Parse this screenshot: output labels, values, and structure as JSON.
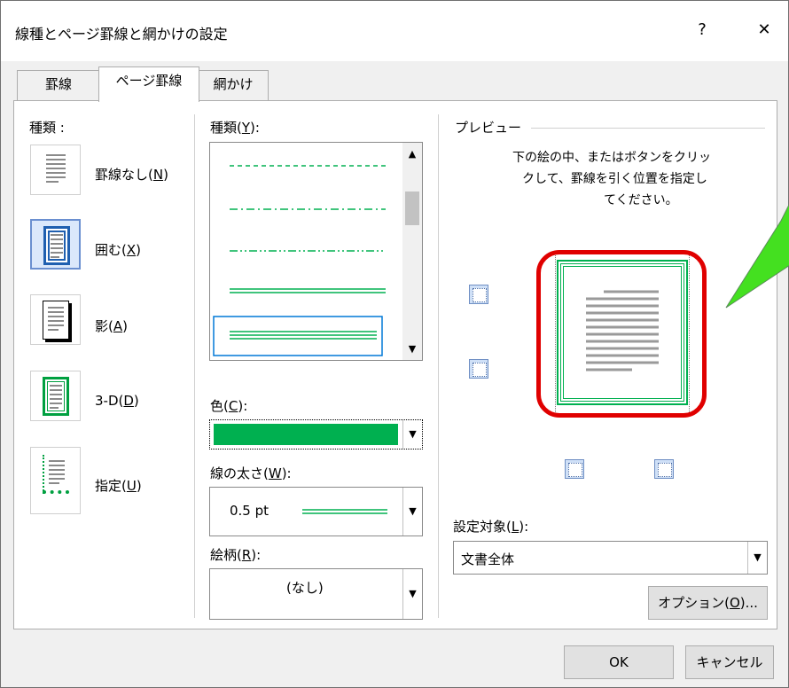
{
  "window": {
    "title": "線種とページ罫線と網かけの設定",
    "help_label": "?",
    "close_label": "✕"
  },
  "tabs": [
    {
      "label": "罫線",
      "active": false
    },
    {
      "label": "ページ罫線",
      "active": true
    },
    {
      "label": "網かけ",
      "active": false
    }
  ],
  "setting": {
    "heading": "種類 :",
    "items": [
      {
        "label": "罫線なし(",
        "key": "N",
        "close": ")"
      },
      {
        "label": "囲む(",
        "key": "X",
        "close": ")"
      },
      {
        "label": "影(",
        "key": "A",
        "close": ")"
      },
      {
        "label": "3-D(",
        "key": "D",
        "close": ")"
      },
      {
        "label": "指定(",
        "key": "U",
        "close": ")"
      }
    ]
  },
  "style": {
    "label_prefix": "種類(",
    "key": "Y",
    "label_suffix": "):"
  },
  "color": {
    "label_prefix": "色(",
    "key": "C",
    "label_suffix": "):",
    "value_hex": "#00b050"
  },
  "width": {
    "label_prefix": "線の太さ(",
    "key": "W",
    "label_suffix": "):",
    "value": "0.5 pt"
  },
  "art": {
    "label_prefix": "絵柄(",
    "key": "R",
    "label_suffix": "):",
    "value": "(なし)"
  },
  "preview": {
    "heading": "プレビュー",
    "instruction_1": "下の絵の中、またはボタンをクリッ",
    "instruction_2": "クして、罫線を引く位置を指定し",
    "instruction_3": "てください。"
  },
  "apply_to": {
    "label_prefix": "設定対象(",
    "key": "L",
    "label_suffix": "):",
    "value": "文書全体"
  },
  "options": {
    "label_prefix": "オプション(",
    "key": "O",
    "label_suffix": ")..."
  },
  "footer": {
    "ok_label": "OK",
    "cancel_label": "キャンセル"
  },
  "colors": {
    "border_green": "#00b050",
    "highlight_red": "#e00000",
    "callout_green": "#44e020",
    "selection_blue": "#0078d7"
  }
}
